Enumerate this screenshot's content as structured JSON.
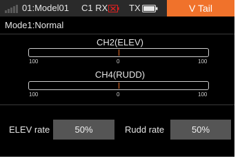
{
  "status_bar": {
    "model": "01:Model01",
    "rx_label": "C1 RX",
    "rx_icon": "rx-disconnected-icon",
    "tx_label": "TX",
    "tx_icon": "battery-icon",
    "mode": "V Tail"
  },
  "header": {
    "mode_title": "Mode1:Normal"
  },
  "channels": [
    {
      "name": "CH2(ELEV)",
      "ticks": [
        "100",
        "0",
        "100"
      ],
      "value": 0
    },
    {
      "name": "CH4(RUDD)",
      "ticks": [
        "100",
        "0",
        "100"
      ],
      "value": 0
    }
  ],
  "rates": {
    "elev_label": "ELEV rate",
    "elev_value": "50%",
    "rudd_label": "Rudd rate",
    "rudd_value": "50%"
  },
  "colors": {
    "accent": "#f0722b",
    "alert": "#e02020",
    "background": "#000000",
    "status_bar": "#2a2a2a",
    "value_box": "#555555"
  }
}
